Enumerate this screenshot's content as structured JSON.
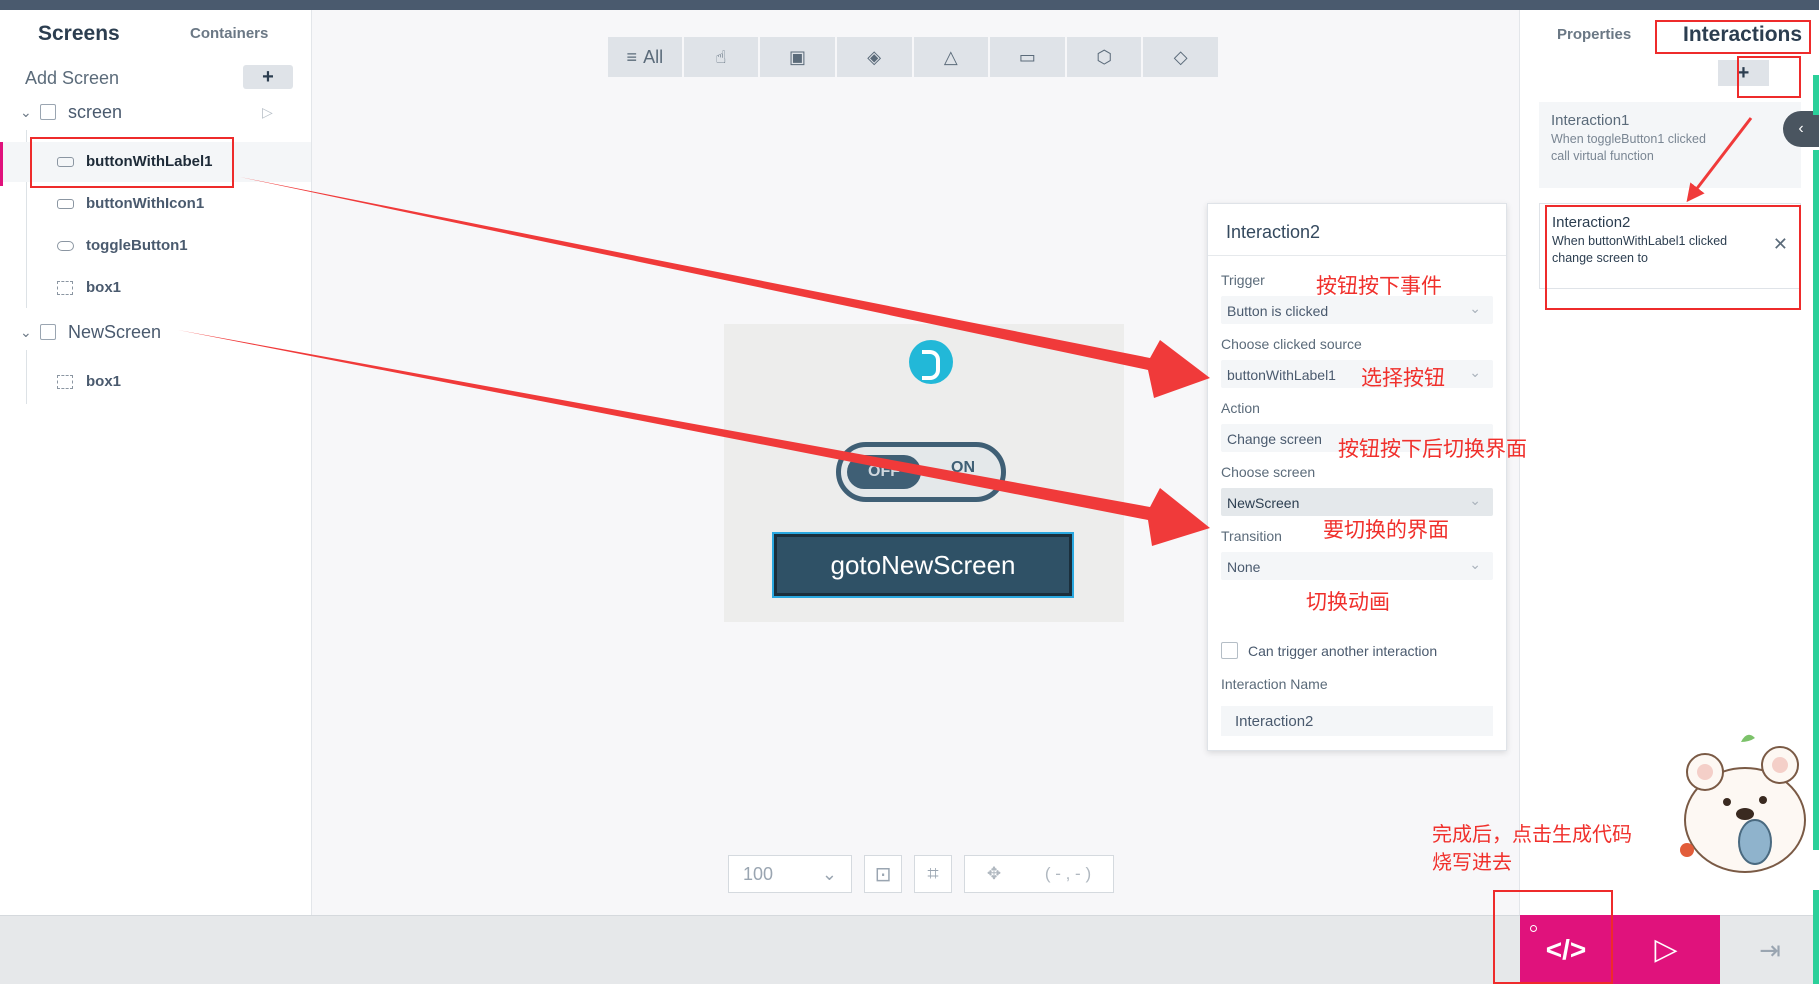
{
  "left_panel": {
    "tab_screens": "Screens",
    "tab_containers": "Containers",
    "add_screen": "Add Screen",
    "add_button": "+",
    "screens": [
      {
        "name": "screen",
        "widgets": [
          "buttonWithLabel1",
          "buttonWithIcon1",
          "toggleButton1",
          "box1"
        ]
      },
      {
        "name": "NewScreen",
        "widgets": [
          "box1"
        ]
      }
    ]
  },
  "toolbar": {
    "all_label": "All"
  },
  "canvas": {
    "toggle_off": "OFF",
    "toggle_on": "ON",
    "button_label": "gotoNewScreen"
  },
  "bottom_controls": {
    "zoom": "100",
    "coords": "( - , - )"
  },
  "popup": {
    "title": "Interaction2",
    "trigger_label": "Trigger",
    "trigger_value": "Button is clicked",
    "source_label": "Choose clicked source",
    "source_value": "buttonWithLabel1",
    "action_label": "Action",
    "action_value": "Change screen",
    "screen_label": "Choose screen",
    "screen_value": "NewScreen",
    "transition_label": "Transition",
    "transition_value": "None",
    "can_trigger_label": "Can trigger another interaction",
    "name_label": "Interaction Name",
    "name_value": "Interaction2"
  },
  "right_panel": {
    "tab_properties": "Properties",
    "tab_interactions": "Interactions",
    "add_button": "+",
    "interactions": [
      {
        "title": "Interaction1",
        "line1": "When toggleButton1 clicked",
        "line2": "call virtual function"
      },
      {
        "title": "Interaction2",
        "line1": "When buttonWithLabel1 clicked",
        "line2": "change screen to"
      }
    ]
  },
  "annotations": {
    "trigger_note": "按钮按下事件",
    "source_note": "选择按钮",
    "action_note": "按钮按下后切换界面",
    "screen_note": "要切换的界面",
    "transition_note": "切换动画",
    "final_note_line1": "完成后，点击生成代码",
    "final_note_line2": "烧写进去"
  },
  "bottom_bar": {
    "code_icon": "</>",
    "run_icon": "▷",
    "exit_icon": "⇥"
  },
  "colors": {
    "accent": "#e0127c",
    "annotation_red": "#ee2b2b",
    "dark_slate": "#2f5166",
    "green_edge": "#2bd09a"
  }
}
